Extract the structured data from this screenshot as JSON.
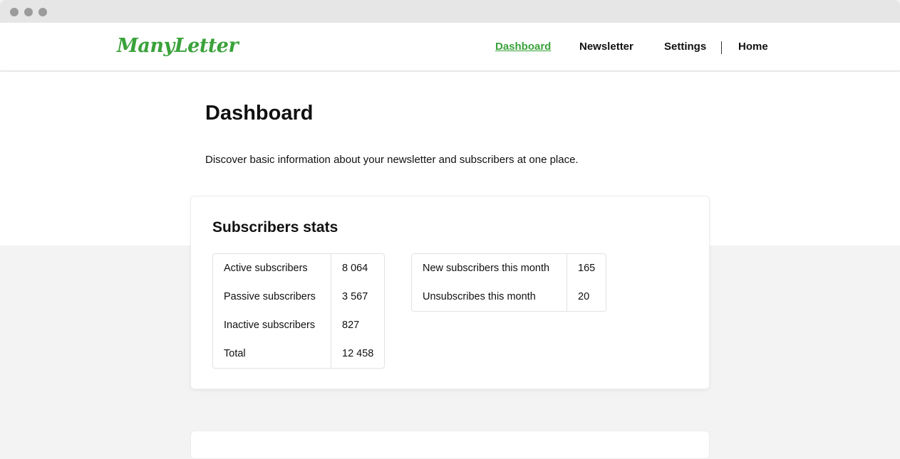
{
  "window": {
    "controls": [
      "dot",
      "dot",
      "dot"
    ]
  },
  "nav": {
    "logo": "ManyLetter",
    "links": [
      {
        "label": "Dashboard",
        "active": true
      },
      {
        "label": "Newsletter",
        "active": false
      },
      {
        "label": "Settings",
        "active": false
      },
      {
        "label": "Home",
        "active": false
      }
    ],
    "accent_color": "#3aa23a"
  },
  "page": {
    "title": "Dashboard",
    "description": "Discover basic information about your newsletter and subscribers at one place."
  },
  "stats_card": {
    "title": "Subscribers stats",
    "left_table": [
      {
        "label": "Active subscribers",
        "value": "8 064"
      },
      {
        "label": "Passive subscribers",
        "value": "3 567"
      },
      {
        "label": "Inactive subscribers",
        "value": "827"
      },
      {
        "label": "Total",
        "value": "12 458"
      }
    ],
    "right_table": [
      {
        "label": "New subscribers this month",
        "value": "165"
      },
      {
        "label": "Unsubscribes this month",
        "value": "20"
      }
    ]
  }
}
